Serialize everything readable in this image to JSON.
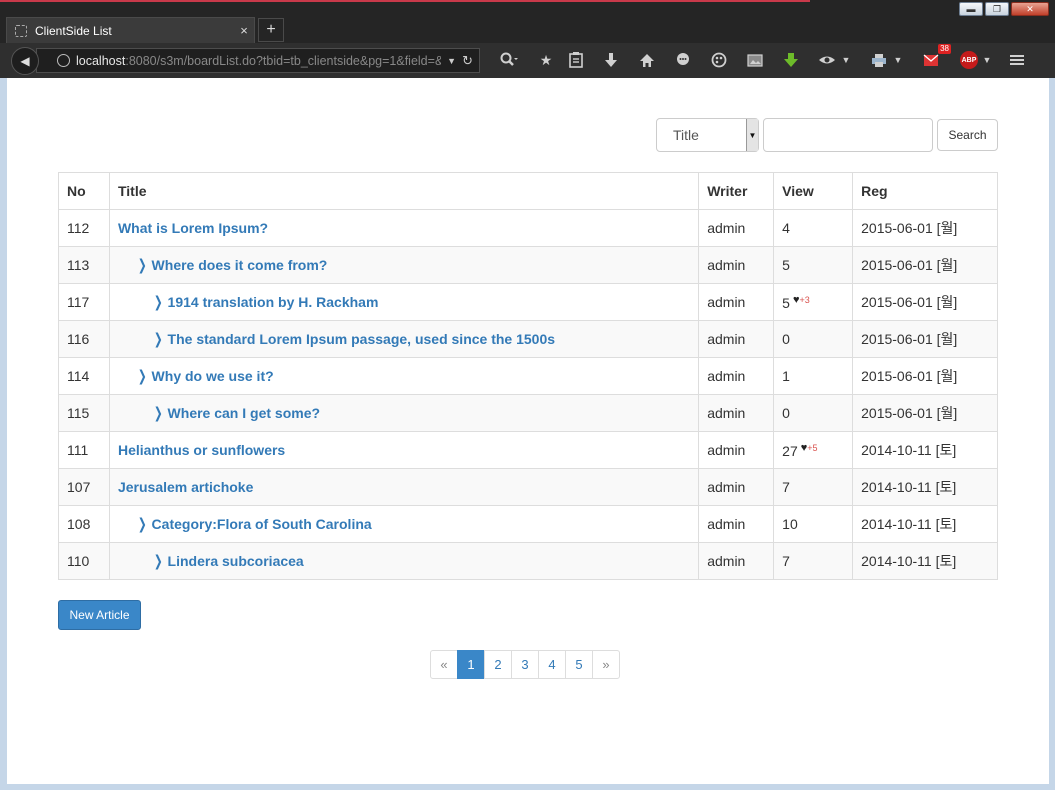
{
  "browser": {
    "tab_title": "ClientSide List",
    "tab_close": "×",
    "new_tab": "+",
    "url_host": "localhost",
    "url_path": ":8080/s3m/boardList.do?tbid=tb_clientside&pg=1&field=&",
    "window_minimize": "▬",
    "window_maximize": "❐",
    "window_close": "✕",
    "icons": [
      "search-icon",
      "star-icon",
      "clipboard-icon",
      "download-icon",
      "home-icon",
      "chat-icon",
      "palette-icon",
      "image-icon",
      "green-download-icon",
      "eye-icon",
      "printer-icon",
      "mail-icon",
      "adblock-icon",
      "menu-icon"
    ],
    "mail_badge": "38",
    "abp_label": "ABP"
  },
  "search": {
    "select_value": "Title",
    "button_label": "Search",
    "input_value": ""
  },
  "table": {
    "headers": [
      "No",
      "Title",
      "Writer",
      "View",
      "Reg"
    ],
    "rows": [
      {
        "no": "112",
        "title": "What is Lorem Ipsum?",
        "level": 0,
        "writer": "admin",
        "view": "4",
        "plus": "",
        "reg": "2015-06-01 [월]"
      },
      {
        "no": "113",
        "title": "Where does it come from?",
        "level": 1,
        "writer": "admin",
        "view": "5",
        "plus": "",
        "reg": "2015-06-01 [월]"
      },
      {
        "no": "117",
        "title": "1914 translation by H. Rackham",
        "level": 2,
        "writer": "admin",
        "view": "5",
        "plus": "+3",
        "reg": "2015-06-01 [월]"
      },
      {
        "no": "116",
        "title": "The standard Lorem Ipsum passage, used since the 1500s",
        "level": 2,
        "writer": "admin",
        "view": "0",
        "plus": "",
        "reg": "2015-06-01 [월]"
      },
      {
        "no": "114",
        "title": "Why do we use it?",
        "level": 1,
        "writer": "admin",
        "view": "1",
        "plus": "",
        "reg": "2015-06-01 [월]"
      },
      {
        "no": "115",
        "title": "Where can I get some?",
        "level": 2,
        "writer": "admin",
        "view": "0",
        "plus": "",
        "reg": "2015-06-01 [월]"
      },
      {
        "no": "111",
        "title": "Helianthus or sunflowers",
        "level": 0,
        "writer": "admin",
        "view": "27",
        "plus": "+5",
        "reg": "2014-10-11 [토]"
      },
      {
        "no": "107",
        "title": "Jerusalem artichoke",
        "level": 0,
        "writer": "admin",
        "view": "7",
        "plus": "",
        "reg": "2014-10-11 [토]"
      },
      {
        "no": "108",
        "title": "Category:Flora of South Carolina",
        "level": 1,
        "writer": "admin",
        "view": "10",
        "plus": "",
        "reg": "2014-10-11 [토]"
      },
      {
        "no": "110",
        "title": "Lindera subcoriacea",
        "level": 2,
        "writer": "admin",
        "view": "7",
        "plus": "",
        "reg": "2014-10-11 [토]"
      }
    ]
  },
  "new_article_label": "New Article",
  "pagination": {
    "prev": "«",
    "pages": [
      "1",
      "2",
      "3",
      "4",
      "5"
    ],
    "active": "1",
    "next": "»"
  }
}
